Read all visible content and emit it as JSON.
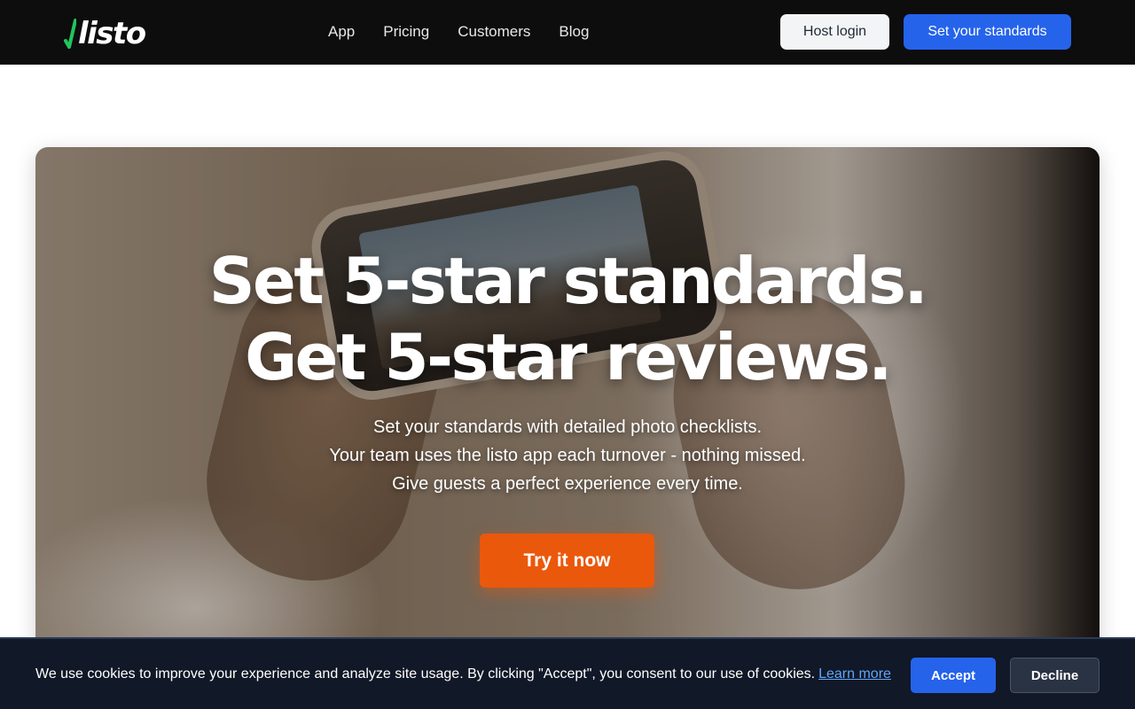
{
  "nav": {
    "logo_text": "listo",
    "logo_icon": "checkmark-icon",
    "links": [
      "App",
      "Pricing",
      "Customers",
      "Blog"
    ],
    "host_login_label": "Host login",
    "cta_label": "Set your standards"
  },
  "hero": {
    "title_line1": "Set 5-star standards.",
    "title_line2": "Get 5-star reviews.",
    "subtitle_lines": [
      "Set your standards with detailed photo checklists.",
      "Your team uses the listo app each turnover - nothing missed.",
      "Give guests a perfect experience every time."
    ],
    "cta_label": "Try it now"
  },
  "cookie_banner": {
    "message": "We use cookies to improve your experience and analyze site usage. By clicking \"Accept\", you consent to our use of cookies.",
    "learn_more_label": "Learn more",
    "accept_label": "Accept",
    "decline_label": "Decline"
  },
  "colors": {
    "nav_bg": "#0d0d0d",
    "primary_blue": "#2563eb",
    "cta_orange": "#ea580c",
    "logo_green": "#22c55e",
    "cookie_bg": "#111827"
  }
}
